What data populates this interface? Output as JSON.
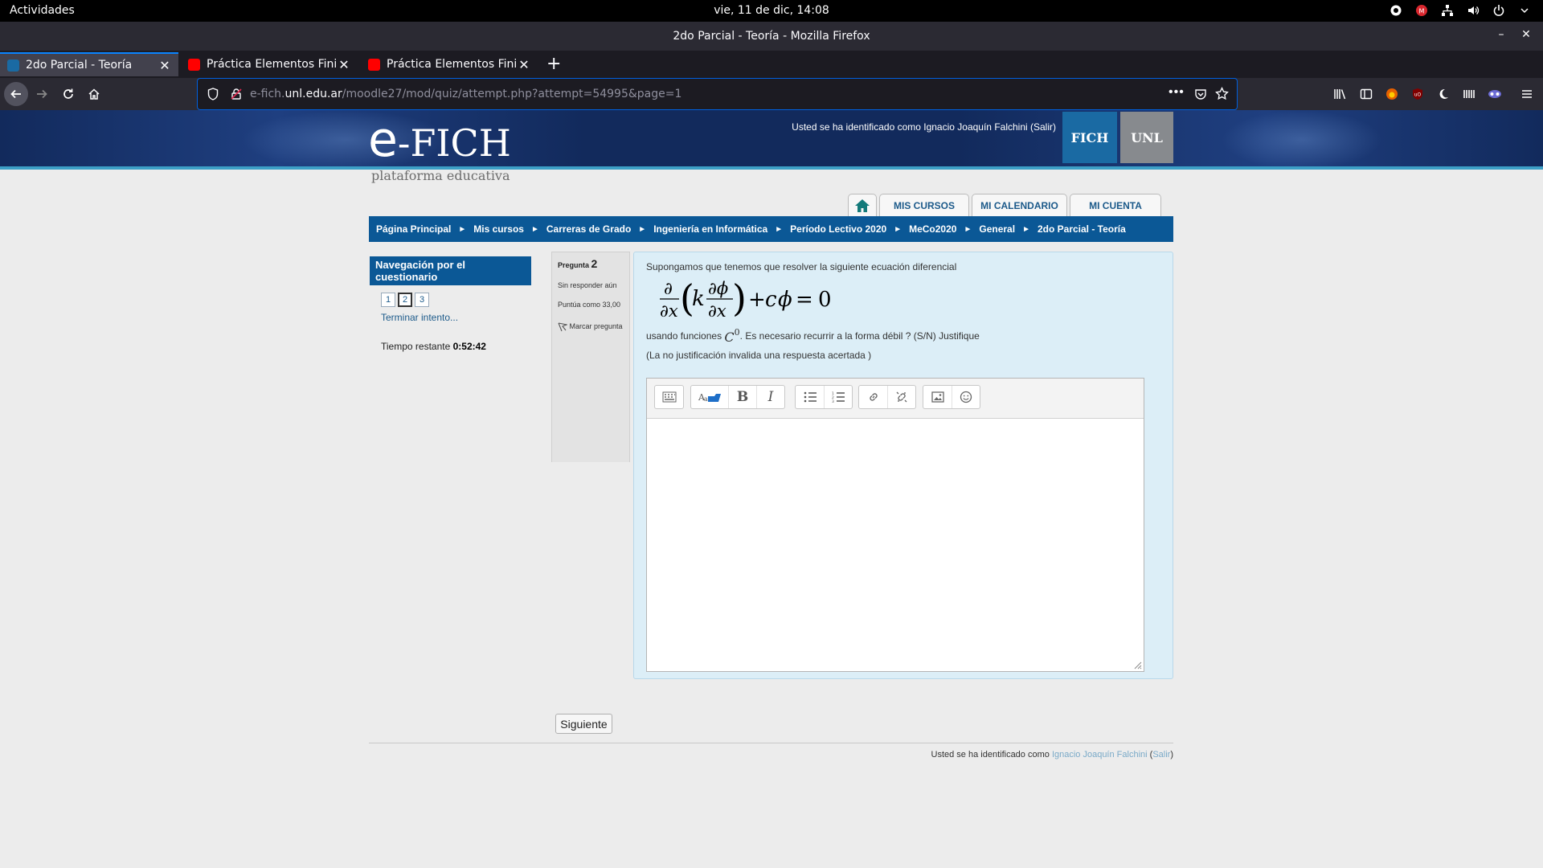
{
  "system_bar": {
    "activities": "Actividades",
    "clock": "vie, 11 de dic, 14:08"
  },
  "window": {
    "title": "2do Parcial - Teoría - Mozilla Firefox"
  },
  "tabs": [
    {
      "label": "2do Parcial - Teoría",
      "active": true,
      "favicon_color": "#1a6aa3"
    },
    {
      "label": "Práctica Elementos Finitos",
      "active": false,
      "favicon_color": "#ff0000"
    },
    {
      "label": "Práctica Elementos Finitos",
      "active": false,
      "favicon_color": "#ff0000"
    }
  ],
  "urlbar": {
    "prefix": "e-fich.",
    "domain": "unl.edu.ar",
    "path": "/moodle27/mod/quiz/attempt.php?attempt=54995&page=1"
  },
  "site": {
    "logo_e": "e",
    "logo_rest": "-FICH",
    "logo_sub": "plataforma educativa",
    "login_info": "Usted se ha identificado como Ignacio Joaquín Falchini (Salir)",
    "fich_label": "FICH",
    "unl_label": "UNL",
    "accent_color": "#0b5896"
  },
  "nav_tabs": [
    "MIS CURSOS",
    "MI CALENDARIO",
    "MI CUENTA"
  ],
  "breadcrumb": [
    "Página Principal",
    "Mis cursos",
    "Carreras de Grado",
    "Ingeniería en Informática",
    "Período Lectivo 2020",
    "MeCo2020",
    "General",
    "2do Parcial - Teoría"
  ],
  "quiz_nav": {
    "title": "Navegación por el cuestionario",
    "buttons": [
      "1",
      "2",
      "3"
    ],
    "current": "2",
    "finish": "Terminar intento...",
    "time_label": "Tiempo restante",
    "time_value": "0:52:42"
  },
  "question_info": {
    "label": "Pregunta",
    "number": "2",
    "status": "Sin responder aún",
    "points": "Puntúa como 33,00",
    "flag": "Marcar pregunta"
  },
  "question": {
    "intro": "Supongamos que tenemos que resolver la siguiente ecuación diferencial",
    "using_before": "usando funciones",
    "c_letter": "C",
    "c_sup": "0",
    "using_after": ". Es necesario recurrir a la forma débil ? (S/N) Justifique",
    "note": "(La no justificación invalida una respuesta acertada )"
  },
  "next_button": "Siguiente",
  "footer": {
    "prefix": "Usted se ha identificado como ",
    "user": "Ignacio Joaquín Falchini",
    "open_paren": " (",
    "logout": "Salir",
    "close_paren": ")"
  }
}
